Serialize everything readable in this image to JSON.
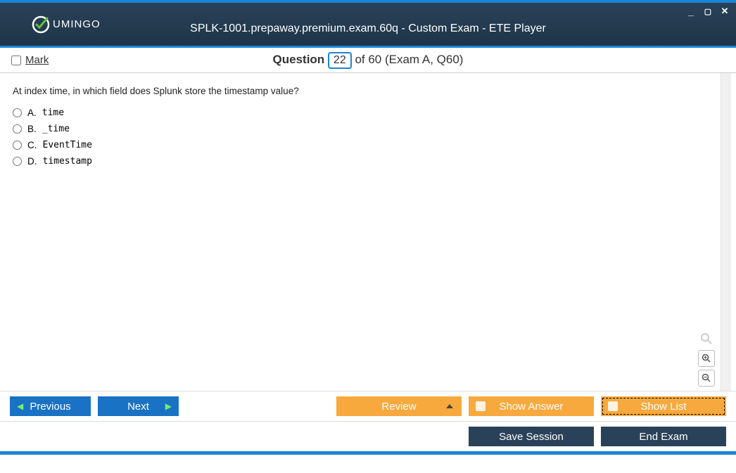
{
  "logo_text": "UMINGO",
  "window_title": "SPLK-1001.prepaway.premium.exam.60q - Custom Exam - ETE Player",
  "mark_label": "Mark",
  "question_label": "Question",
  "current_question": "22",
  "total_tail": " of 60 (Exam A, Q60)",
  "question_text": "At index time, in which field does Splunk store the timestamp value?",
  "options": [
    {
      "letter": "A.",
      "value": "time"
    },
    {
      "letter": "B.",
      "value": "_time"
    },
    {
      "letter": "C.",
      "value": "EventTime"
    },
    {
      "letter": "D.",
      "value": "timestamp"
    }
  ],
  "buttons": {
    "previous": "Previous",
    "next": "Next",
    "review": "Review",
    "show_answer": "Show Answer",
    "show_list": "Show List",
    "save_session": "Save Session",
    "end_exam": "End Exam"
  }
}
